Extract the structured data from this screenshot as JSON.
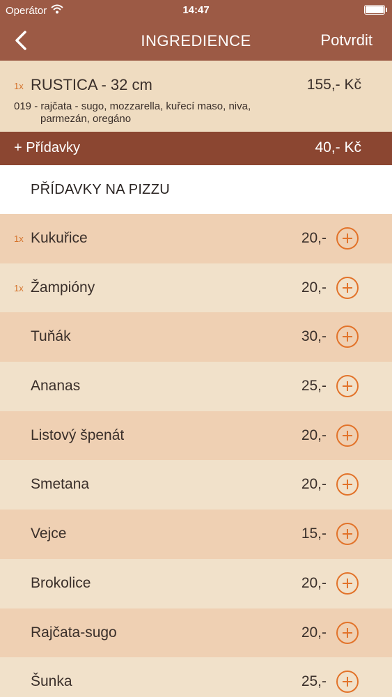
{
  "status_bar": {
    "carrier": "Operátor",
    "time": "14:47",
    "icons": [
      "wifi-icon",
      "battery-icon"
    ]
  },
  "nav": {
    "title": "INGREDIENCE",
    "confirm_label": "Potvrdit",
    "back_icon": "chevron-left-icon"
  },
  "order": {
    "qty": "1x",
    "name": "RUSTICA - 32 cm",
    "price": "155,- Kč",
    "description_line1": "019 - rajčata - sugo, mozzarella, kuřecí maso, niva,",
    "description_line2": "parmezán, oregáno"
  },
  "extras_bar": {
    "label": "+ Přídavky",
    "price": "40,- Kč"
  },
  "section": {
    "heading": "PŘÍDAVKY NA PIZZU"
  },
  "items": [
    {
      "count": "1x",
      "name": "Kukuřice",
      "price": "20,-"
    },
    {
      "count": "1x",
      "name": "Žampióny",
      "price": "20,-"
    },
    {
      "count": "",
      "name": "Tuňák",
      "price": "30,-"
    },
    {
      "count": "",
      "name": "Ananas",
      "price": "25,-"
    },
    {
      "count": "",
      "name": "Listový špenát",
      "price": "20,-"
    },
    {
      "count": "",
      "name": "Smetana",
      "price": "20,-"
    },
    {
      "count": "",
      "name": "Vejce",
      "price": "15,-"
    },
    {
      "count": "",
      "name": "Brokolice",
      "price": "20,-"
    },
    {
      "count": "",
      "name": "Rajčata-sugo",
      "price": "20,-"
    },
    {
      "count": "",
      "name": "Šunka",
      "price": "25,-"
    }
  ],
  "colors": {
    "header": "#9c5a45",
    "extras_bar": "#8b4631",
    "accent": "#e2732a",
    "row_odd": "#efd0b3",
    "row_even": "#f1e1ca"
  }
}
